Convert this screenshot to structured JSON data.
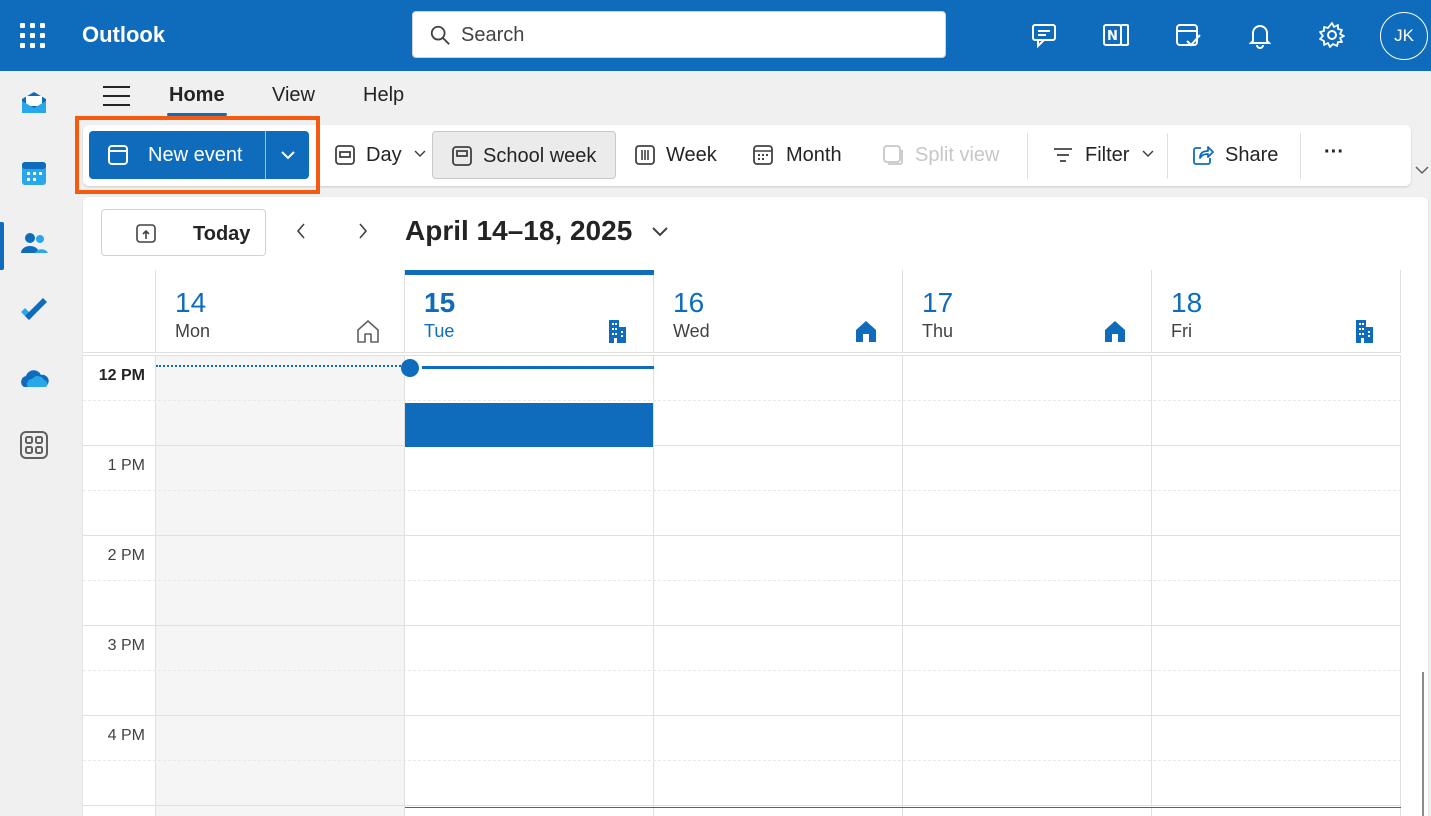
{
  "app": {
    "title": "Outlook",
    "user_initials": "JK"
  },
  "search": {
    "placeholder": "Search"
  },
  "top_icons": [
    "feedback-icon",
    "onenote-icon",
    "my-day-icon",
    "bell-icon",
    "gear-icon"
  ],
  "rail": [
    "mail-icon",
    "calendar-icon",
    "people-icon",
    "todo-icon",
    "onedrive-icon",
    "apps-icon"
  ],
  "menu": {
    "tabs": [
      "Home",
      "View",
      "Help"
    ],
    "active": "Home"
  },
  "ribbon": {
    "new_event": "New event",
    "day": "Day",
    "school_week": "School week",
    "week": "Week",
    "month": "Month",
    "split_view": "Split view",
    "filter": "Filter",
    "share": "Share",
    "more": "···"
  },
  "calendar": {
    "today_label": "Today",
    "date_range": "April 14–18, 2025",
    "days": [
      {
        "num": "14",
        "name": "Mon",
        "location": "home-outline-icon"
      },
      {
        "num": "15",
        "name": "Tue",
        "location": "office-building-icon"
      },
      {
        "num": "16",
        "name": "Wed",
        "location": "home-icon"
      },
      {
        "num": "17",
        "name": "Thu",
        "location": "home-icon"
      },
      {
        "num": "18",
        "name": "Fri",
        "location": "office-building-icon"
      }
    ],
    "times": [
      "12 PM",
      "1 PM",
      "2 PM",
      "3 PM",
      "4 PM"
    ]
  },
  "colors": {
    "brand": "#0f6cbd",
    "highlight": "#f55a0f"
  }
}
